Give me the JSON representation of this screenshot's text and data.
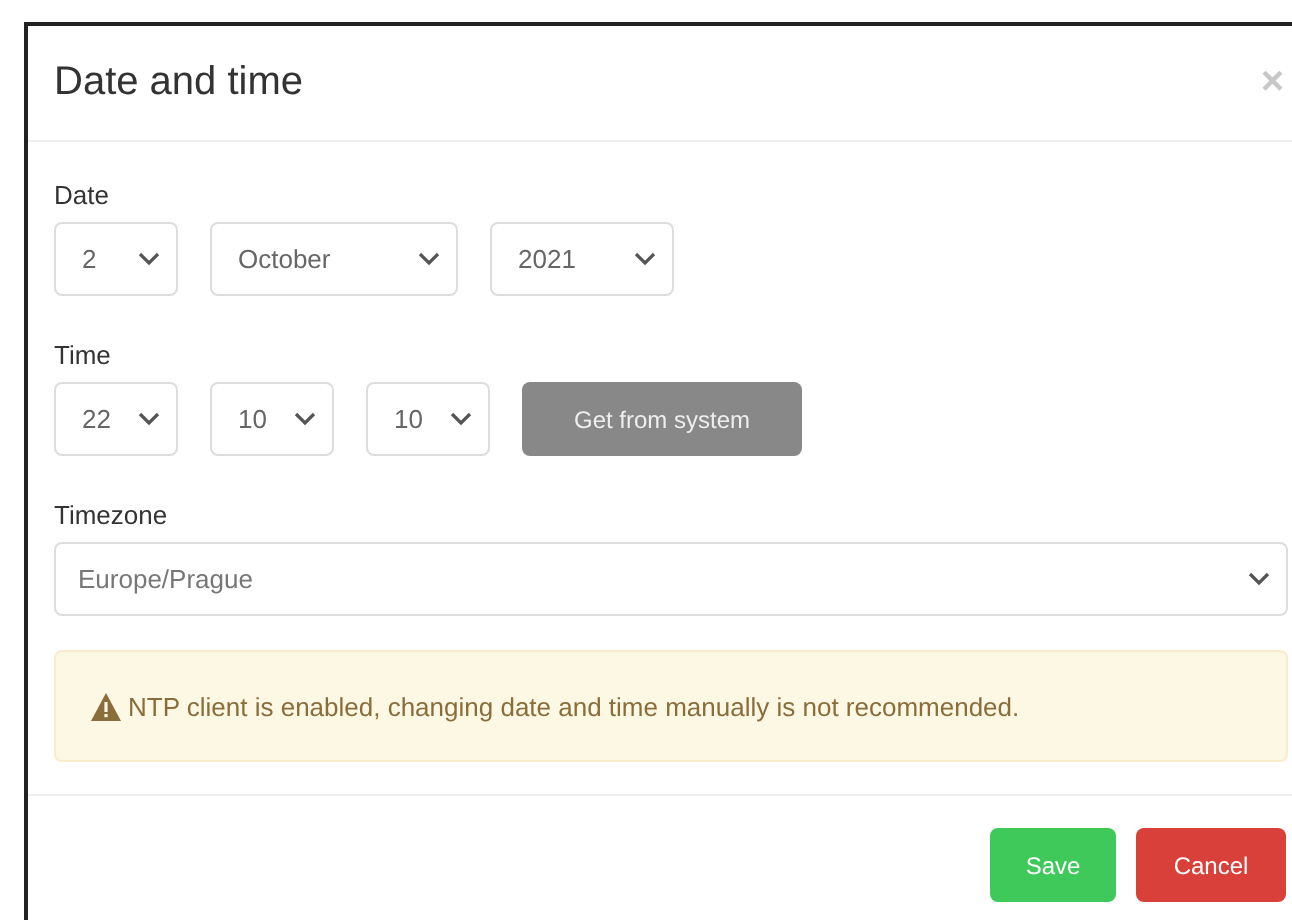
{
  "dialog": {
    "title": "Date and time",
    "close": "×"
  },
  "date": {
    "label": "Date",
    "selects": [
      {
        "value": "2"
      },
      {
        "value": "October"
      },
      {
        "value": "2021"
      }
    ]
  },
  "time": {
    "label": "Time",
    "selects": [
      {
        "value": "22"
      },
      {
        "value": "10"
      },
      {
        "value": "10"
      }
    ],
    "button": {
      "label": "Get from system",
      "disabled": true
    }
  },
  "timezone": {
    "label": "Timezone",
    "value": "Europe/Prague"
  },
  "alert": {
    "kind": "warning",
    "text": "NTP client is enabled, changing date and time manually is not recommended."
  },
  "buttons": [
    {
      "label": "Save",
      "kind": "success"
    },
    {
      "label": "Cancel",
      "kind": "danger"
    }
  ]
}
